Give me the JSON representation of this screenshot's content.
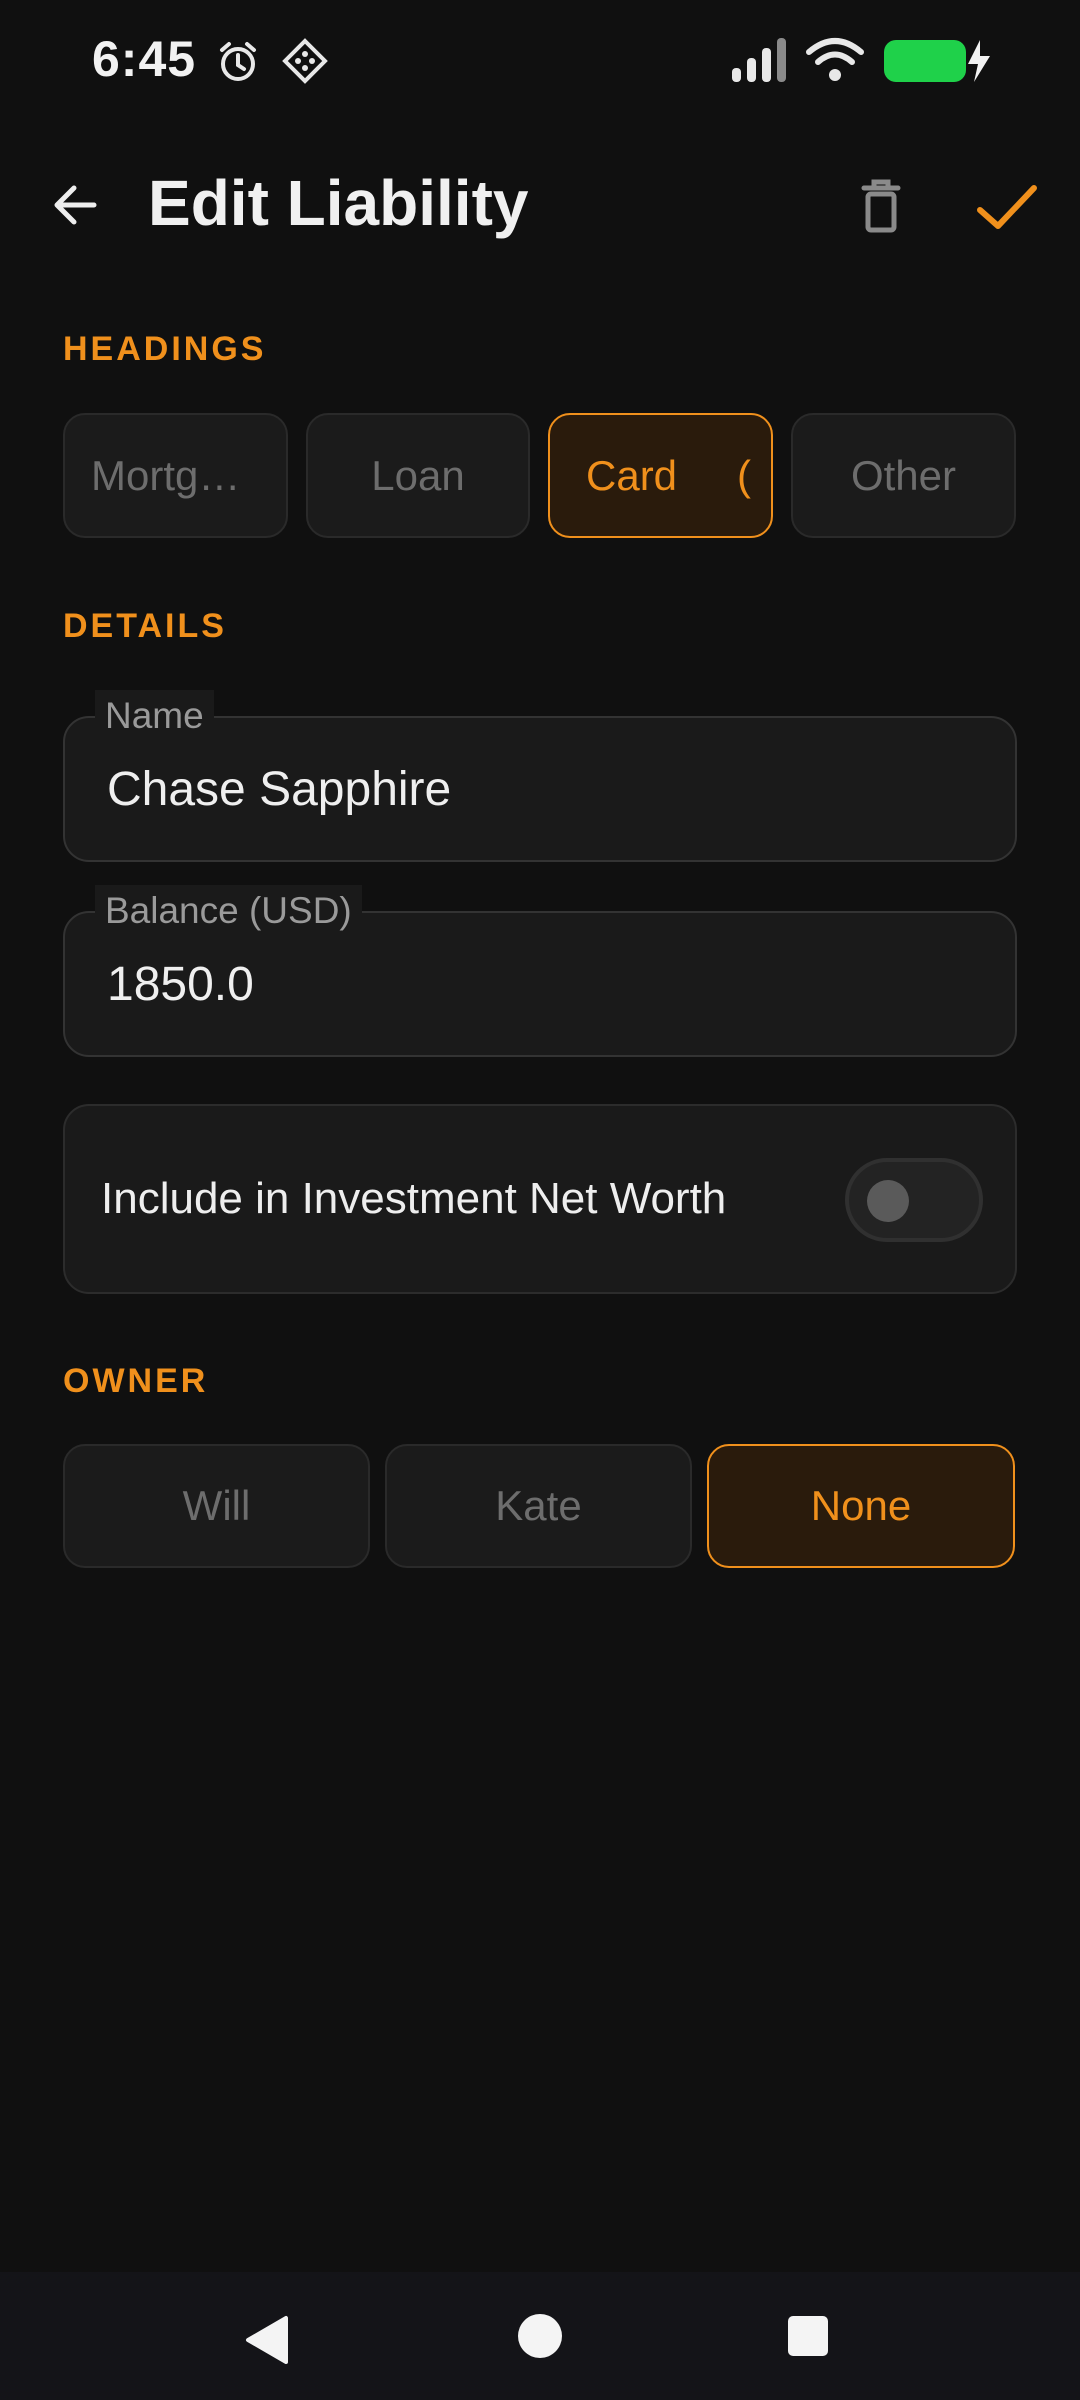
{
  "status_bar": {
    "time": "6:45",
    "icons": [
      "alarm-icon",
      "app-notification-icon",
      "signal-icon",
      "wifi-icon",
      "battery-charging-icon"
    ],
    "battery_color": "#1fd14a"
  },
  "app_bar": {
    "title": "Edit Liability",
    "back_icon": "arrow-left-icon",
    "delete_icon": "trash-icon",
    "save_icon": "check-icon"
  },
  "headings": {
    "header": "HEADINGS",
    "chips": [
      {
        "label": "Mortg…",
        "selected": false
      },
      {
        "label": "Loan",
        "selected": false
      },
      {
        "label": "Card",
        "selected": true
      },
      {
        "label": "Other",
        "selected": false
      }
    ],
    "selected_chip_overflow": "("
  },
  "details": {
    "header": "DETAILS",
    "name_label": "Name",
    "name_value": "Chase Sapphire",
    "balance_label": "Balance (USD)",
    "balance_value": "1850.0",
    "toggle_label": "Include in Investment Net Worth",
    "toggle_on": false
  },
  "owner": {
    "header": "OWNER",
    "chips": [
      {
        "label": "Will",
        "selected": false
      },
      {
        "label": "Kate",
        "selected": false
      },
      {
        "label": "None",
        "selected": true
      }
    ]
  },
  "colors": {
    "accent": "#f0901c",
    "background": "#101010",
    "surface": "#1a1a1a"
  },
  "nav_bar": {
    "icons": [
      "back-triangle-icon",
      "home-circle-icon",
      "recents-square-icon"
    ]
  }
}
